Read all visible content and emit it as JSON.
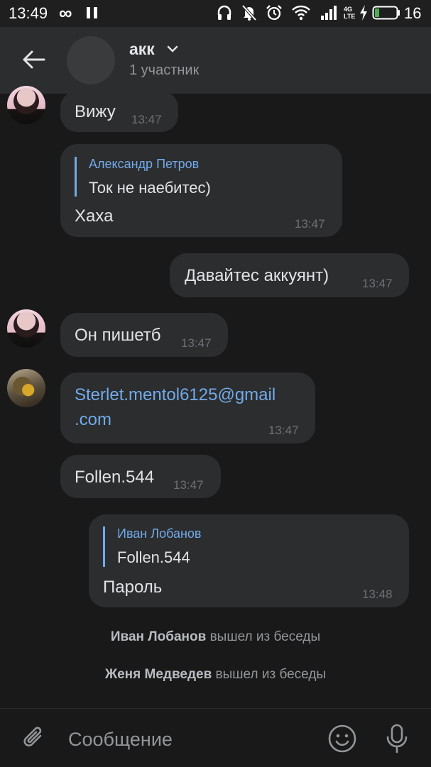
{
  "status_bar": {
    "time": "13:49",
    "infinity_glyph": "∞",
    "network_label_top": "4G",
    "network_label_bottom": "LTE",
    "battery_percent": "16",
    "icons": [
      "infinity-icon",
      "pause-icon",
      "headphones-icon",
      "mute-icon",
      "alarm-icon",
      "wifi-icon",
      "signal-icon",
      "charging-icon",
      "battery-icon"
    ]
  },
  "header": {
    "title": "акк",
    "subtitle": "1 участник",
    "icons": [
      "back-arrow-icon",
      "chevron-down-icon"
    ]
  },
  "messages": [
    {
      "side": "in",
      "text": "Вижу",
      "time": "13:47"
    },
    {
      "side": "in",
      "reply_author": "Александр Петров",
      "reply_text": "Ток не наебитес)",
      "text": "Хаха",
      "time": "13:47"
    },
    {
      "side": "out",
      "text": "Давайтес аккуянт)",
      "time": "13:47"
    },
    {
      "side": "in",
      "text": "Он пишетб",
      "time": "13:47"
    },
    {
      "side": "in",
      "link_line1": "Sterlet.mentol6125@gmail",
      "link_line2": ".com",
      "time": "13:47"
    },
    {
      "side": "in",
      "text": "Follen.544",
      "time": "13:47"
    },
    {
      "side": "out",
      "reply_author": "Иван Лобанов",
      "reply_text": "Follen.544",
      "text": "Пароль",
      "time": "13:48"
    }
  ],
  "service_messages": [
    {
      "name": "Иван Лобанов",
      "action": "вышел из беседы"
    },
    {
      "name": "Женя Медведев",
      "action": "вышел из беседы"
    }
  ],
  "composer": {
    "placeholder": "Сообщение",
    "icons": [
      "attach-icon",
      "emoji-icon",
      "microphone-icon"
    ]
  },
  "colors": {
    "background": "#19191a",
    "bubble": "#2c2d2e",
    "accent": "#71aaeb",
    "text": "#e1e3e6",
    "secondary": "#939699"
  }
}
